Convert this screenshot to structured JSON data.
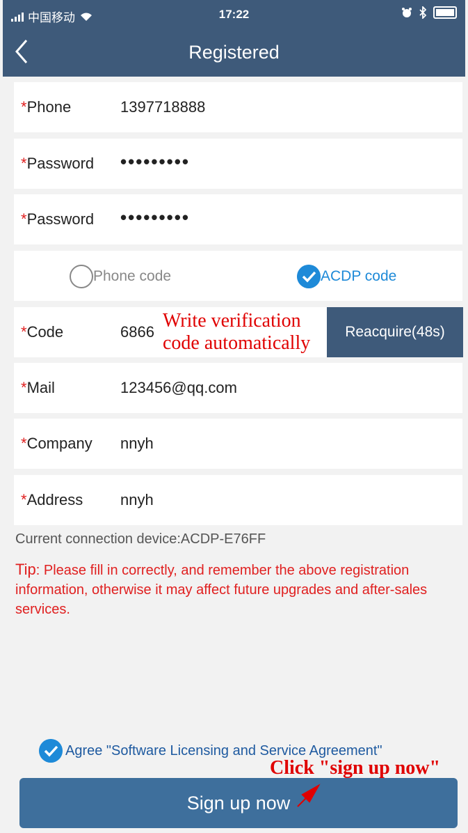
{
  "status_bar": {
    "carrier": "中国移动",
    "time": "17:22"
  },
  "nav": {
    "title": "Registered"
  },
  "form": {
    "phone": {
      "label": "Phone",
      "value": "1397718888"
    },
    "password1": {
      "label": "Password",
      "value": "•••••••••"
    },
    "password2": {
      "label": "Password",
      "value": "•••••••••"
    },
    "code_type": {
      "phone_label": "Phone code",
      "acdp_label": "ACDP code",
      "selected": "ACDP code"
    },
    "code": {
      "label": "Code",
      "value": "6866",
      "button_label": "Reacquire(48s)"
    },
    "mail": {
      "label": "Mail",
      "value": "123456@qq.com"
    },
    "company": {
      "label": "Company",
      "value": "nnyh"
    },
    "address": {
      "label": "Address",
      "value": "nnyh"
    },
    "required_mark": "*"
  },
  "annotations": {
    "code_note_line1": "Write verification",
    "code_note_line2": "code automatically",
    "signup_note": "Click \"sign up now\""
  },
  "device": "Current connection device:ACDP-E76FF",
  "tip": {
    "label": "Tip",
    "text": ": Please fill in correctly, and remember the above registration information, otherwise it may affect future upgrades and after-sales services."
  },
  "agreement": {
    "label": "Agree \"Software Licensing and Service Agreement\"",
    "checked": true
  },
  "signup_button": "Sign up now",
  "colors": {
    "nav": "#3e5a7a",
    "button": "#3e6f9c",
    "accent_blue": "#1e8ad8",
    "required_red": "#e02020",
    "annotation_red": "#e00000"
  }
}
